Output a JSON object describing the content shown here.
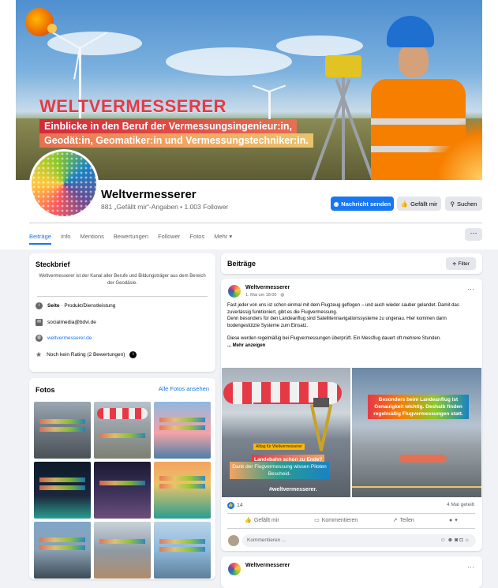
{
  "cover": {
    "brand": "WELTVERMESSERER",
    "tagline_1": "Einblicke in den Beruf der Vermessungsingenieur:in,",
    "tagline_2": "Geodät:in, Geomatiker:in und Vermessungstechniker:in."
  },
  "profile": {
    "name": "Weltvermesserer",
    "stats": "881 „Gefällt mir“-Angaben • 1.003 Follower"
  },
  "buttons": {
    "message": "Nachricht senden",
    "like": "Gefällt mir",
    "search": "Suchen"
  },
  "tabs": [
    "Beiträge",
    "Info",
    "Mentions",
    "Bewertungen",
    "Follower",
    "Fotos",
    "Mehr ▾"
  ],
  "more_menu": "···",
  "intro": {
    "title": "Steckbrief",
    "description": "Weltvermesserer ist der Kanal aller Berufe und Bildungsträger aus dem Bereich der Geodäsie.",
    "category_bold": "Seite",
    "category": " · Produkt/Dienstleistung",
    "email": "socialmedia@bdvi.de",
    "website": "weltvermesserer.de",
    "rating": "Noch kein Rating (2 Bewertungen)"
  },
  "photos": {
    "title": "Fotos",
    "all_link": "Alle Fotos ansehen"
  },
  "feed": {
    "title": "Beiträge",
    "filter": "Filter"
  },
  "post": {
    "author": "Weltvermesserer",
    "date": "1. Mai um 18:00 · ",
    "text_1": "Fast jeder von uns ist schon einmal mit dem Flugzeug geflogen – und auch wieder sauber gelandet. Damit das zuverlässig funktioniert, gibt es die Flugvermessung.",
    "text_2": "Denn besonders für den Landeanflug sind Satellitennavigationssysteme zu ungenau. Hier kommen dann bodengestützte Systeme zum Einsatz.",
    "text_3": "Diese werden regelmäßig bei Flugvermessungen überprüft. Ein Messflug dauert oft mehrere Stunden.",
    "more": "... Mehr anzeigen",
    "image1_tag": "Alltag für Weltvermesserer",
    "image1_title": "Landebahn schon zu Ende?",
    "image1_sub": "Dank der Flugvermessung wissen Piloten Bescheid.",
    "image1_hashtag": "#weltvermesserer.",
    "image2_text": "Besonders beim Landeanflug ist Genauigkeit wichtig. Deshalb finden regelmäßig Flugvermessungen statt.",
    "reactions": "14",
    "shares": "4 Mal geteilt",
    "action_like": "Gefällt mir",
    "action_comment": "Kommentieren",
    "action_share": "Teilen",
    "comment_placeholder": "Kommentieren ..."
  },
  "post2": {
    "author": "Weltvermesserer"
  },
  "colors": {
    "accent": "#1877f2",
    "brand_red": "#e63946",
    "background": "#f0f2f5"
  }
}
